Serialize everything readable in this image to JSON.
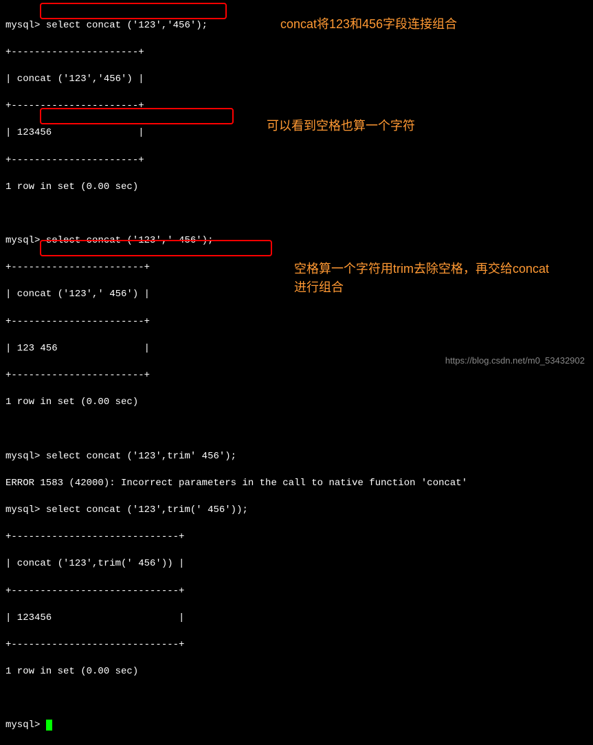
{
  "block1": {
    "prompt": "mysql>",
    "cmd": "select concat ('123','456');",
    "sep": "+----------------------+",
    "header": "| concat ('123','456') |",
    "result": "| 123456               |",
    "footer": "1 row in set (0.00 sec)"
  },
  "block2": {
    "prompt": "mysql>",
    "cmd": "select concat ('123',' 456');",
    "sep": "+-----------------------+",
    "header": "| concat ('123',' 456') |",
    "result": "| 123 456               |",
    "footer": "1 row in set (0.00 sec)"
  },
  "block3": {
    "prompt": "mysql>",
    "errcmd": "select concat ('123',trim' 456');",
    "errmsg": "ERROR 1583 (42000): Incorrect parameters in the call to native function 'concat'",
    "cmd": "select concat ('123',trim(' 456'));",
    "sep": "+-----------------------------+",
    "header": "| concat ('123',trim(' 456')) |",
    "result": "| 123456                      |",
    "footer": "1 row in set (0.00 sec)"
  },
  "final_prompt": "mysql>",
  "annotations": {
    "a1": "concat将123和456字段连接组合",
    "a2": "可以看到空格也算一个字符",
    "a3": "空格算一个字符用trim去除空格，再交给concat进行组合"
  },
  "watermark": "https://blog.csdn.net/m0_53432902"
}
